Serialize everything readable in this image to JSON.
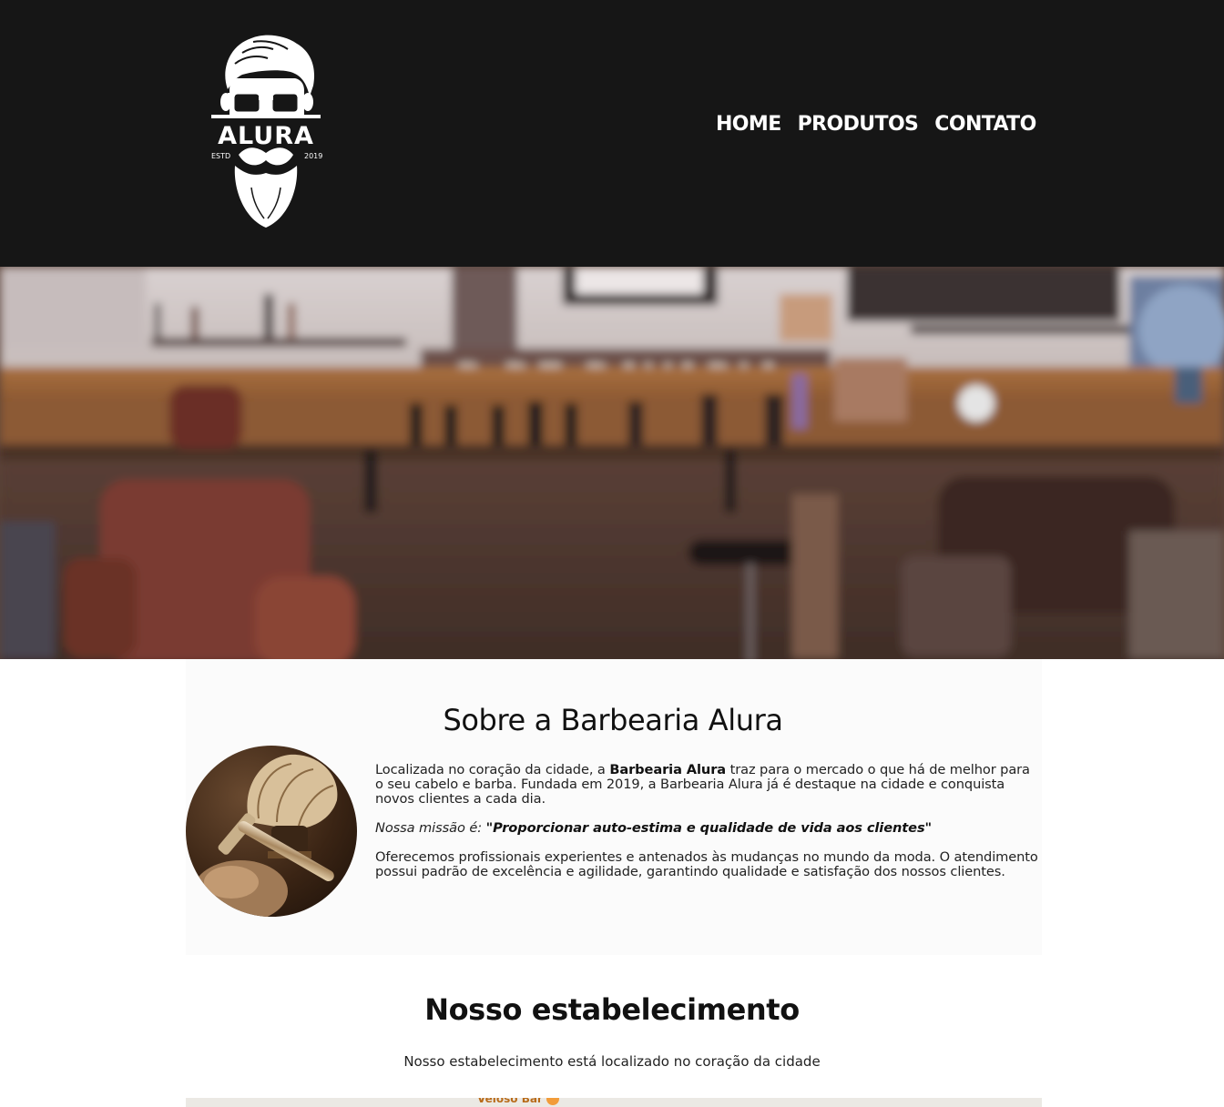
{
  "header": {
    "logo": {
      "brand": "ALURA",
      "estd_label": "ESTD",
      "year": "2019"
    },
    "nav": [
      {
        "label": "HOME"
      },
      {
        "label": "PRODUTOS"
      },
      {
        "label": "CONTATO"
      }
    ]
  },
  "about": {
    "title": "Sobre a Barbearia Alura",
    "p1_before": "Localizada no coração da cidade, a ",
    "p1_strong": "Barbearia Alura",
    "p1_after": " traz para o mercado o que há de melhor para o seu cabelo e barba. Fundada em 2019, a Barbearia Alura já é destaque na cidade e conquista novos clientes a cada dia.",
    "mission_label": "Nossa missão é: ",
    "mission_quote": "\"Proporcionar auto-estima e qualidade de vida aos clientes\"",
    "p3": "Oferecemos profissionais experientes e antenados às mudanças no mundo da moda. O atendimento possui padrão de excelência e agilidade, garantindo qualidade e satisfação dos nossos clientes."
  },
  "location": {
    "title": "Nosso estabelecimento",
    "subtitle": "Nosso estabelecimento está localizado no coração da cidade",
    "map_label": "Veloso Bar"
  },
  "colors": {
    "header_bg": "#161616",
    "nav_text": "#ffffff",
    "about_bg": "#fbfbfb"
  }
}
